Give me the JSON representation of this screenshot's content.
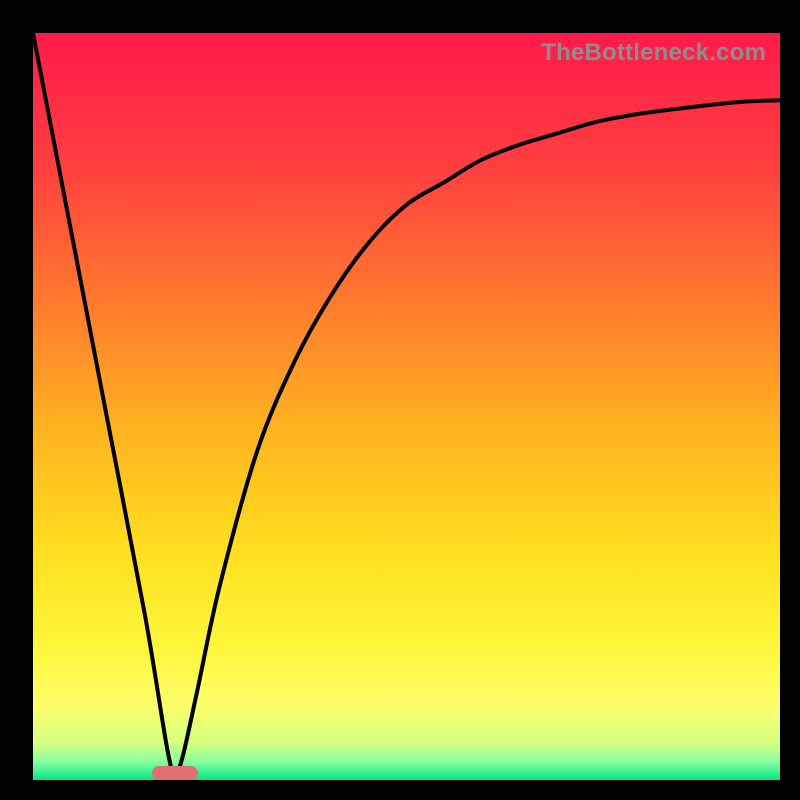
{
  "watermark": "TheBottleneck.com",
  "colors": {
    "gradient_stops": [
      {
        "offset": 0.0,
        "color": "#ff1a4b"
      },
      {
        "offset": 0.18,
        "color": "#ff3f3f"
      },
      {
        "offset": 0.36,
        "color": "#ff7a2e"
      },
      {
        "offset": 0.54,
        "color": "#ffb61f"
      },
      {
        "offset": 0.7,
        "color": "#ffe021"
      },
      {
        "offset": 0.82,
        "color": "#fff63a"
      },
      {
        "offset": 0.9,
        "color": "#fcff6a"
      },
      {
        "offset": 0.95,
        "color": "#d6ff80"
      },
      {
        "offset": 0.975,
        "color": "#8affa0"
      },
      {
        "offset": 1.0,
        "color": "#00e884"
      }
    ],
    "curve": "#000000",
    "marker": "#e17070",
    "frame": "#000000"
  },
  "chart_data": {
    "type": "line",
    "title": "",
    "xlabel": "",
    "ylabel": "",
    "xlim": [
      0,
      100
    ],
    "ylim": [
      0,
      100
    ],
    "grid": false,
    "legend": false,
    "notes": "Bottleneck-style curve. Y ≈ mismatch/bottleneck percentage (0 at bottom = no bottleneck, 100 at top = full bottleneck). Single V-shaped curve with minimum near x≈19; right branch rises then plateaus. Values estimated from pixel positions.",
    "optimal_x": 19,
    "marker": {
      "x": 19,
      "y": 1,
      "shape": "pill"
    },
    "series": [
      {
        "name": "bottleneck-curve",
        "x": [
          0,
          5,
          10,
          15,
          18,
          19,
          20,
          22,
          25,
          30,
          35,
          40,
          45,
          50,
          55,
          60,
          65,
          70,
          75,
          80,
          85,
          90,
          95,
          100
        ],
        "values": [
          100,
          74,
          48,
          22,
          4,
          1,
          3,
          12,
          26,
          44,
          56,
          65,
          72,
          77,
          80,
          83,
          85,
          86.5,
          88,
          89,
          89.7,
          90.3,
          90.8,
          91
        ]
      }
    ]
  }
}
